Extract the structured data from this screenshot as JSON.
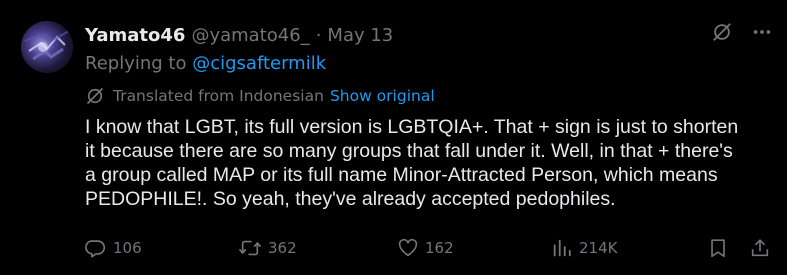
{
  "author": {
    "display_name": "Yamato46",
    "handle": "@yamato46_",
    "separator": "·",
    "date": "May 13"
  },
  "reply": {
    "prefix": "Replying to",
    "mention": "@cigsaftermilk"
  },
  "translation": {
    "label": "Translated from Indonesian",
    "show_original": "Show original"
  },
  "text": "I know that LGBT, its full version is LGBTQIA+. That + sign is just to shorten\nit because there are so many groups that fall under it. Well, in that + there's\na group called MAP or its full name Minor-Attracted Person, which means\nPEDOPHILE!. So yeah, they've already accepted pedophiles.",
  "metrics": {
    "replies": "106",
    "reposts": "362",
    "likes": "162",
    "views": "214K"
  },
  "icons": {
    "avatar": "avatar-image",
    "translate": "translate-icon",
    "more": "more-icon",
    "reply": "reply-icon",
    "repost": "repost-icon",
    "like": "heart-icon",
    "views": "views-icon",
    "bookmark": "bookmark-icon",
    "share": "share-icon"
  },
  "colors": {
    "background": "#000000",
    "text": "#e7e9ea",
    "muted": "#71767b",
    "link": "#1d9bf0"
  }
}
